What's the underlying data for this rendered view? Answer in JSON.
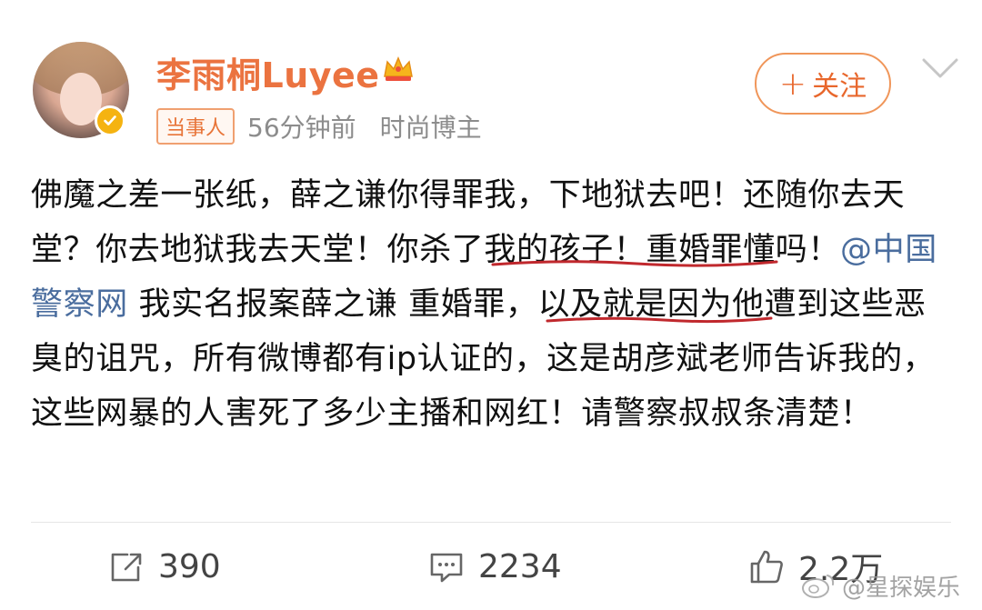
{
  "user": {
    "name": "李雨桐Luyee",
    "badge": "当事人",
    "time": "56分钟前",
    "source": "时尚博主"
  },
  "follow": {
    "plus": "+",
    "label": "关注"
  },
  "post": {
    "seg1": "佛魔之差一张纸，薛之谦你得罪我，下地狱去吧！还随你去天堂？你去地狱我去天堂！你杀了我的孩子！重婚罪懂吗！",
    "mention": "@中国警察网",
    "seg2": " 我实名报案薛之谦 重婚罪，以及就是因为他遭到这些恶臭的诅咒，所有微博都有ip认证的，这是胡彦斌老师告诉我的，这些网暴的人害死了多少主播和网红！请警察叔叔条清楚！"
  },
  "actions": {
    "repost_count": "390",
    "comment_count": "2234",
    "like_count": "2.2万"
  },
  "watermark": "@星探娱乐",
  "colors": {
    "username": "#eb7340",
    "mention": "#4a6d9e",
    "underline": "#c0282d",
    "follow": "#e8672c"
  }
}
